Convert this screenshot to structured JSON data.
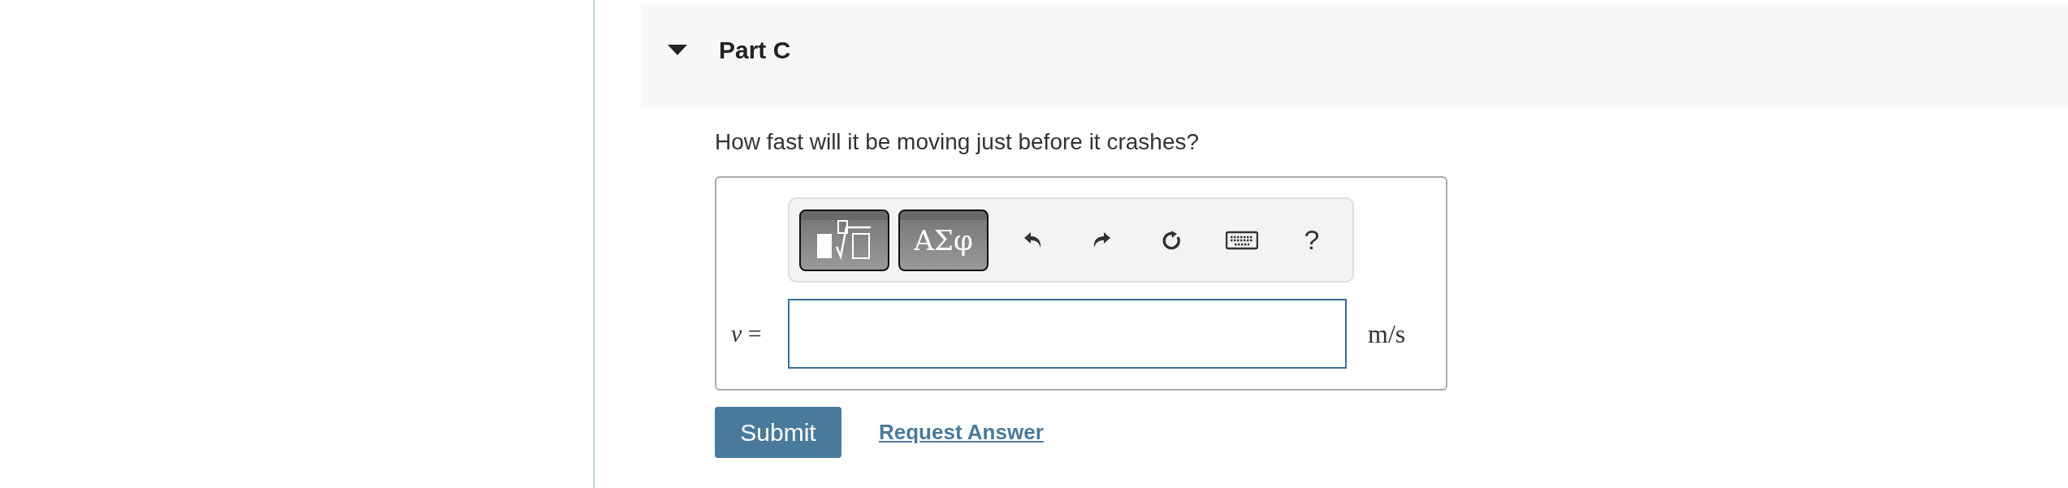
{
  "part": {
    "title": "Part C",
    "expanded": true
  },
  "question": "How fast will it be moving just before it crashes?",
  "toolbar": [
    {
      "kind": "templates"
    },
    {
      "kind": "symbols",
      "label": "ΑΣφ"
    },
    {
      "kind": "undo"
    },
    {
      "kind": "redo"
    },
    {
      "kind": "reset"
    },
    {
      "kind": "keyboard"
    },
    {
      "kind": "help",
      "label": "?"
    }
  ],
  "answer": {
    "label": "*v* =",
    "unit": "m/s"
  },
  "submit": "Submit",
  "request_answer": "Request Answer"
}
